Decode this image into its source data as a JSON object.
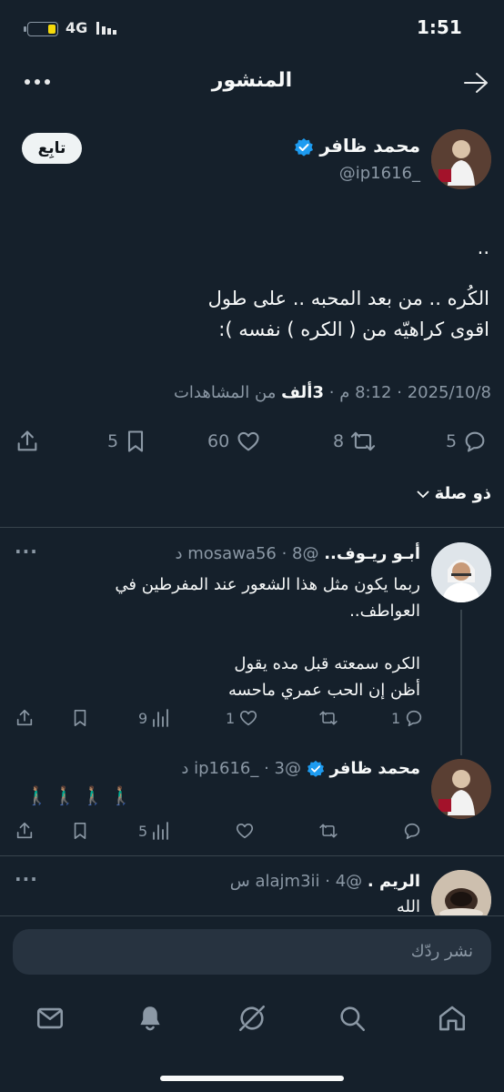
{
  "status_bar": {
    "time": "1:51",
    "network": "4G"
  },
  "header": {
    "title": "المنشور"
  },
  "post": {
    "author_name": "محمد ظافر",
    "handle": "@ip1616_",
    "follow_label": "تابِع",
    "text_line1": "..",
    "text_line2": "الكُره .. من بعد المحبه .. على طول",
    "text_line3": "اقوى كراهيّه من ( الكره ) نفسه ):",
    "date": "2025/10/8",
    "sep1": "·",
    "time": "8:12 م",
    "sep2": "·",
    "views_count": "3ألف",
    "views_label": "من المشاهدات",
    "replies": "5",
    "reposts": "8",
    "likes": "60",
    "bookmarks": "5"
  },
  "filter": {
    "label": "ذو صلة"
  },
  "replies": [
    {
      "name": "أبـو ريـوف..",
      "meta": "@mosawa56 · 8 د",
      "line1": "ربما يكون مثل هذا الشعور عند المفرطين في",
      "line2": "العواطف..",
      "line3": "الكره سمعته قبل مده يقول",
      "line4": "أظن إن الحب عمري ماحسه",
      "replies": "1",
      "reposts": "",
      "likes": "1",
      "views": "9"
    },
    {
      "name": "محمد ظافر",
      "meta": "@ip1616_ · 3 د",
      "line1": "🚶🏽‍♂️🚶🏽‍♂️🚶🏽‍♂️🚶🏽‍♂️",
      "views": "5"
    },
    {
      "name": "الريم .",
      "meta": "@alajm3ii · 4 س",
      "line1": "الله"
    }
  ],
  "composer": {
    "placeholder": "نشر ردّك"
  },
  "colors": {
    "background": "#15202b",
    "accent": "#1d9bf0",
    "text": "#f7f9f9",
    "muted": "#8b98a5"
  },
  "icons": [
    "back-arrow-icon",
    "more-icon",
    "verified-icon",
    "reply-icon",
    "repost-icon",
    "like-icon",
    "bookmark-icon",
    "share-icon",
    "views-icon",
    "chevron-down-icon",
    "mail-icon",
    "bell-icon",
    "grok-icon",
    "search-icon",
    "home-icon"
  ]
}
